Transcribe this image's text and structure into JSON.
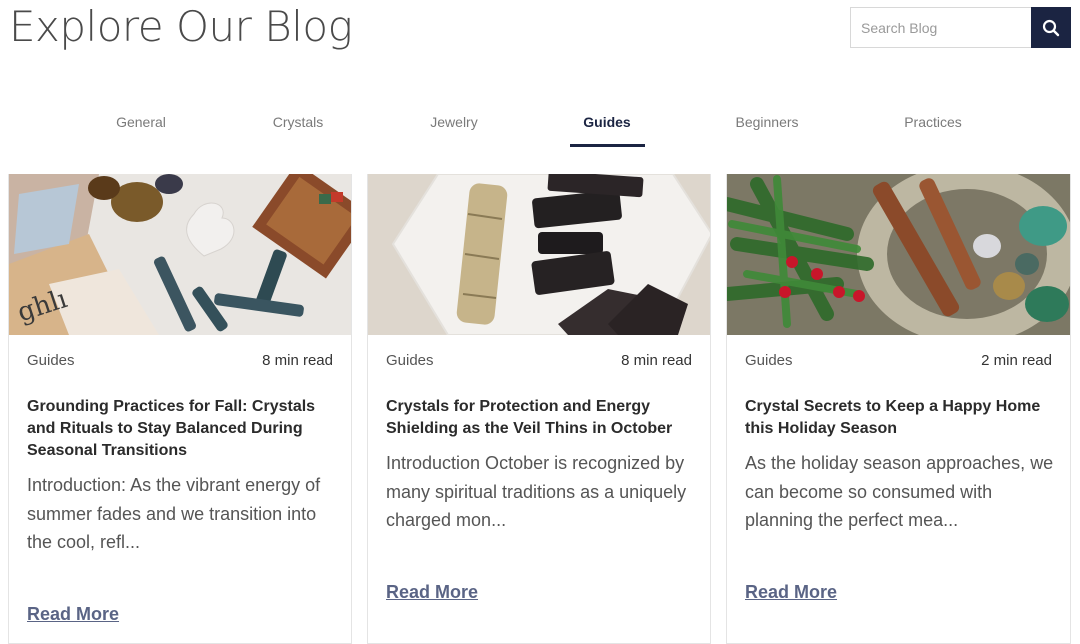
{
  "header": {
    "title": "Explore Our Blog"
  },
  "search": {
    "placeholder": "Search Blog",
    "icon": "search-icon"
  },
  "tabs": [
    {
      "label": "General",
      "active": false
    },
    {
      "label": "Crystals",
      "active": false
    },
    {
      "label": "Jewelry",
      "active": false
    },
    {
      "label": "Guides",
      "active": true
    },
    {
      "label": "Beginners",
      "active": false
    },
    {
      "label": "Practices",
      "active": false
    }
  ],
  "cards": [
    {
      "category": "Guides",
      "read_time": "8 min read",
      "title": "Grounding Practices for Fall: Crystals and Rituals to Stay Balanced During Seasonal Transitions",
      "excerpt": "Introduction: As the vibrant energy of summer fades and we transition into the cool, refl...",
      "link": "Read More"
    },
    {
      "category": "Guides",
      "read_time": "8 min read",
      "title": "Crystals for Protection and Energy Shielding as the Veil Thins in October",
      "excerpt": "Introduction October is recognized by many spiritual traditions as a uniquely charged mon...",
      "link": "Read More"
    },
    {
      "category": "Guides",
      "read_time": "2 min read",
      "title": "Crystal Secrets to Keep a Happy Home this Holiday Season",
      "excerpt": "As the holiday season approaches, we can become so consumed with planning the perfect mea...",
      "link": "Read More"
    }
  ],
  "colors": {
    "accent": "#1b2442",
    "link": "#5a6485"
  }
}
